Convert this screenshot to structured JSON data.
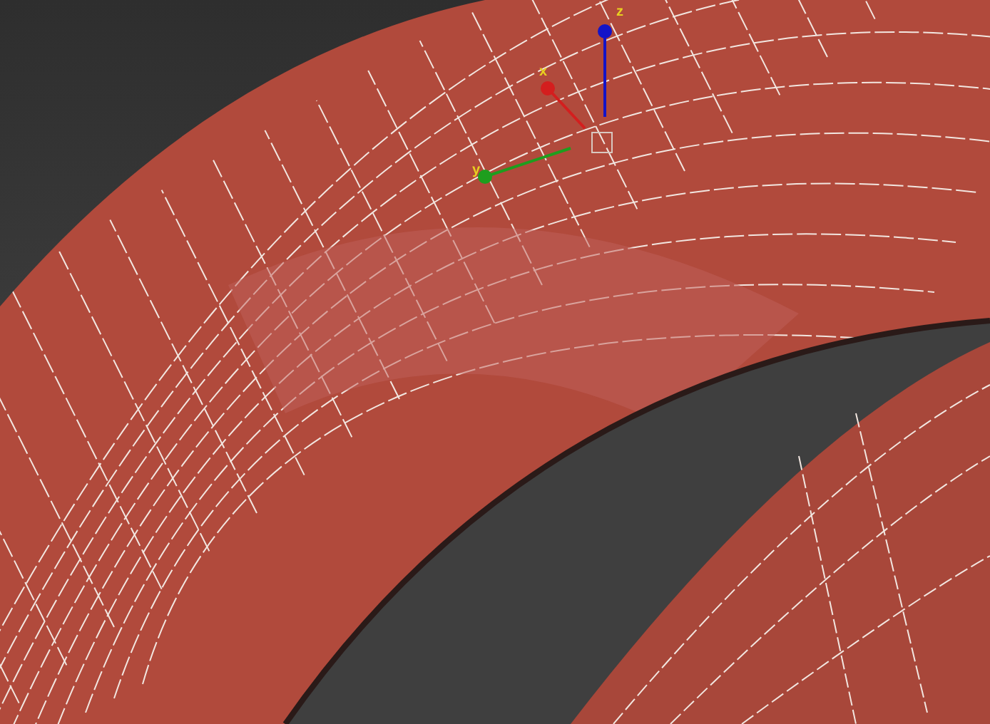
{
  "viewport": {
    "gizmo_axes": [
      {
        "label": "z",
        "color": "#1414c8"
      },
      {
        "label": "x",
        "color": "#d41e1e"
      },
      {
        "label": "y",
        "color": "#1e9e1e"
      }
    ]
  }
}
